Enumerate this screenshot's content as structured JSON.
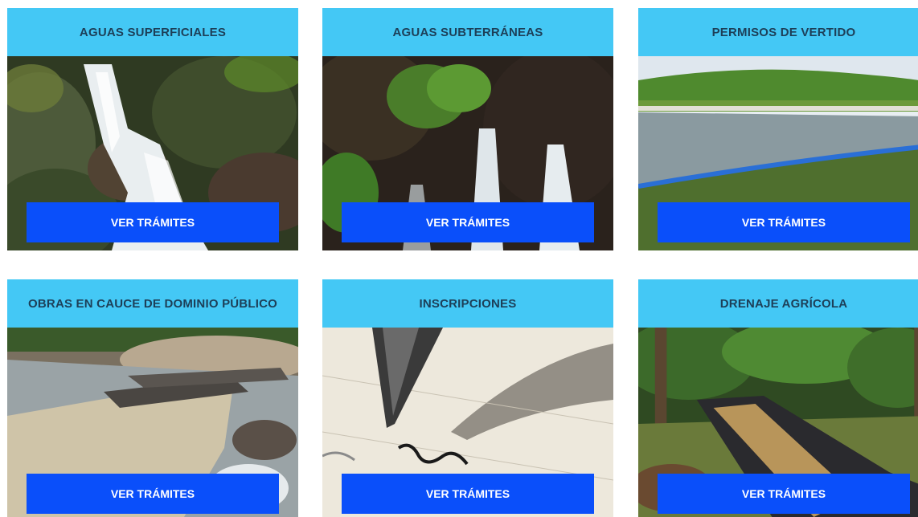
{
  "cards": [
    {
      "title": "AGUAS SUPERFICIALES",
      "button": "VER TRÁMITES",
      "image": "waterfall-photo"
    },
    {
      "title": "AGUAS SUBTERRÁNEAS",
      "button": "VER TRÁMITES",
      "image": "spring-rock-photo"
    },
    {
      "title": "PERMISOS DE VERTIDO",
      "button": "VER TRÁMITES",
      "image": "lagoon-photo"
    },
    {
      "title": "OBRAS EN CAUCE DE DOMINIO PÚBLICO",
      "button": "VER TRÁMITES",
      "image": "river-works-photo"
    },
    {
      "title": "INSCRIPCIONES",
      "button": "VER TRÁMITES",
      "image": "pen-writing-photo"
    },
    {
      "title": "DRENAJE AGRÍCOLA",
      "button": "VER TRÁMITES",
      "image": "drainage-canal-photo"
    }
  ],
  "colors": {
    "header_bg": "#44c8f5",
    "header_text": "#1d3f58",
    "button_bg": "#0a4ffa",
    "button_text": "#ffffff"
  }
}
